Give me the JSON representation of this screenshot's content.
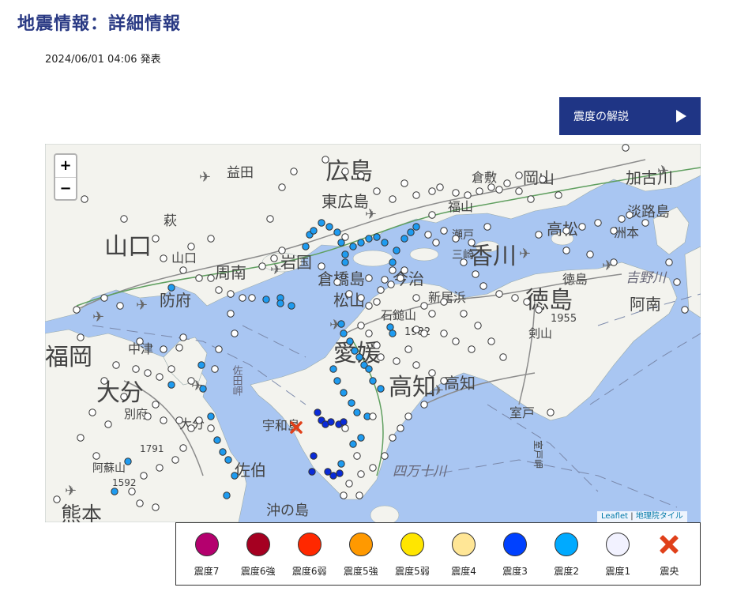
{
  "page": {
    "title": "地震情報：詳細情報",
    "issued": "2024/06/01 04:06 発表",
    "explain_button": "震度の解説"
  },
  "map": {
    "zoom_in": "+",
    "zoom_out": "−",
    "attribution_leaflet": "Leaflet",
    "attribution_separator": "|",
    "attribution_tiles": "地理院タイル",
    "labels": {
      "hiroshima": "広島",
      "higashihiroshima": "東広島",
      "yamaguchi": "山口",
      "yamaguchi_city": "山口",
      "hofu": "防府",
      "shunan": "周南",
      "iwakuni": "岩国",
      "kurahashi": "倉橋島",
      "imabari": "今治",
      "matsuyama": "松山",
      "ehime": "愛媛",
      "kochi_pref": "高知",
      "kochi_city": "高知",
      "kagawa": "香川",
      "tokushima_pref": "徳島",
      "tokushima_city": "徳島",
      "takamatsu": "高松",
      "okayama": "岡山",
      "kurashiki": "倉敷",
      "fukuyama": "福山",
      "oita_pref": "大分",
      "oita_city": "大分",
      "fukuoka": "福岡",
      "nakatsu": "中津",
      "saiki": "佐伯",
      "uwajima": "宇和島",
      "okinoshima": "沖の島",
      "muroto": "室戸",
      "muroto_cape": "室戸岬",
      "niihama": "新居浜",
      "ishizuchi": "石鎚山",
      "ishizuchi_elev": "1982",
      "tsurugi": "剣山",
      "tsurugi_elev": "1955",
      "yoshino": "吉野川",
      "shimanto": "四万十川",
      "anan": "阿南",
      "kakogawa": "加古川",
      "awaji": "淡路島",
      "sumoto": "洲本",
      "hagi": "萩",
      "masuda": "益田",
      "kumamoto": "熊本",
      "aso": "阿蘇山",
      "aso_elev": "1592",
      "kuju_elev": "1791",
      "sada": "佐田岬",
      "beppu": "別府",
      "seto": "瀬戸",
      "mitoyo": "三崎"
    }
  },
  "legend": [
    {
      "label": "震度7",
      "color": "#b4006e"
    },
    {
      "label": "震度6強",
      "color": "#a50021"
    },
    {
      "label": "震度6弱",
      "color": "#ff2800"
    },
    {
      "label": "震度5強",
      "color": "#ff9900"
    },
    {
      "label": "震度5弱",
      "color": "#ffe600"
    },
    {
      "label": "震度4",
      "color": "#ffe696"
    },
    {
      "label": "震度3",
      "color": "#0041ff"
    },
    {
      "label": "震度2",
      "color": "#00aaff"
    },
    {
      "label": "震度1",
      "color": "#f2f2ff"
    },
    {
      "label": "震央",
      "icon": "epicenter-cross-icon"
    }
  ],
  "colors": {
    "accent": "#1f3585",
    "sea": "#a9c6f2",
    "land": "#f3f3ee",
    "shindo3": "#0041ff",
    "shindo2": "#1e9bf0",
    "shindo1": "#ffffff",
    "epicenter": "#e0401a"
  }
}
